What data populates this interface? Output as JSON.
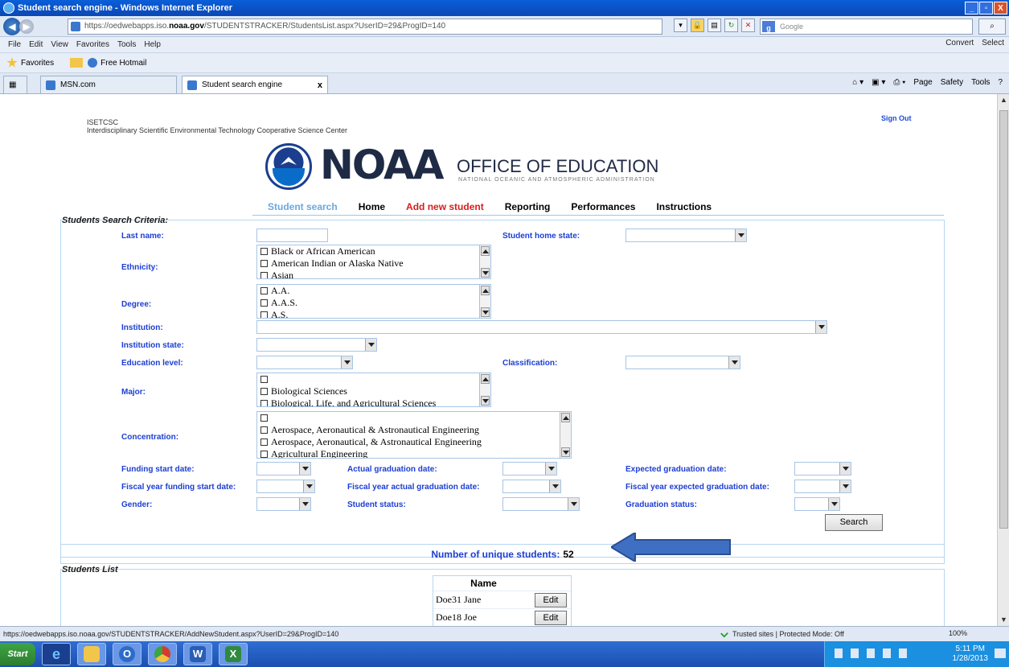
{
  "browser": {
    "window_title": "Student search engine - Windows Internet Explorer",
    "window_controls": [
      "_",
      "▫",
      "X"
    ],
    "address_url_prefix": "https://oedwebapps.iso.",
    "address_url_domain": "noaa.gov",
    "address_url_path": "/STUDENTSTRACKER/StudentsList.aspx?UserID=29&ProgID=140",
    "search_placeholder": "Google",
    "menu": [
      "File",
      "Edit",
      "View",
      "Favorites",
      "Tools",
      "Help"
    ],
    "menu_right": [
      "Convert",
      "Select"
    ],
    "favorites_label": "Favorites",
    "favorites_items": [
      "Free Hotmail"
    ],
    "tabs": [
      {
        "label": "MSN.com"
      },
      {
        "label": "Student search engine",
        "close": "x"
      }
    ],
    "command_bar": [
      "Page",
      "Safety",
      "Tools"
    ],
    "status_url": "https://oedwebapps.iso.noaa.gov/STUDENTSTRACKER/AddNewStudent.aspx?UserID=29&ProgID=140",
    "status_zone": "Trusted sites | Protected Mode: Off",
    "zoom": "100%"
  },
  "page": {
    "org_abbr": "ISETCSC",
    "org_name": "Interdisciplinary Scientific Environmental Technology Cooperative Science Center",
    "sign_out": "Sign Out",
    "banner_logo_text": "NOAA",
    "banner_title": "OFFICE OF EDUCATION",
    "banner_subtitle": "NATIONAL OCEANIC AND ATMOSPHERIC ADMINISTRATION",
    "nav": [
      "Student search",
      "Home",
      "Add new student",
      "Reporting",
      "Performances",
      "Instructions"
    ]
  },
  "search": {
    "section_title": "Students Search Criteria:",
    "labels": {
      "last_name": "Last name:",
      "student_home_state": "Student home state:",
      "ethnicity": "Ethnicity:",
      "degree": "Degree:",
      "institution": "Institution:",
      "institution_state": "Institution state:",
      "education_level": "Education level:",
      "classification": "Classification:",
      "major": "Major:",
      "concentration": "Concentration:",
      "funding_start_date": "Funding start date:",
      "actual_graduation_date": "Actual graduation date:",
      "expected_graduation_date": "Expected graduation date:",
      "fy_funding_start_date": "Fiscal year funding start date:",
      "fy_actual_graduation_date": "Fiscal year actual graduation date:",
      "fy_expected_graduation_date": "Fiscal year expected graduation date:",
      "gender": "Gender:",
      "student_status": "Student status:",
      "graduation_status": "Graduation status:"
    },
    "ethnicity_options": [
      "Black or African American",
      "American Indian or Alaska Native",
      "Asian"
    ],
    "degree_options": [
      "A.A.",
      "A.A.S.",
      "A.S."
    ],
    "major_options": [
      "",
      "Biological Sciences",
      "Biological, Life, and Agricultural Sciences"
    ],
    "concentration_options": [
      "",
      "Aerospace, Aeronautical & Astronautical Engineering",
      "Aerospace, Aeronautical, & Astronautical Engineering",
      "Agricultural Engineering"
    ],
    "search_button": "Search"
  },
  "results": {
    "count_label": "Number of unique students:",
    "count_value": "52",
    "section_title": "Students List",
    "column_name": "Name",
    "edit_label": "Edit",
    "rows": [
      {
        "name": "Doe31 Jane"
      },
      {
        "name": "Doe18 Joe"
      }
    ]
  },
  "taskbar": {
    "start": "Start",
    "time": "5:11 PM",
    "date": "1/28/2013"
  },
  "colors": {
    "label_blue": "#1c3ed3",
    "nav_active": "#6aa7e0",
    "nav_red": "#d81d1d",
    "arrow": "#3e6fc2"
  }
}
